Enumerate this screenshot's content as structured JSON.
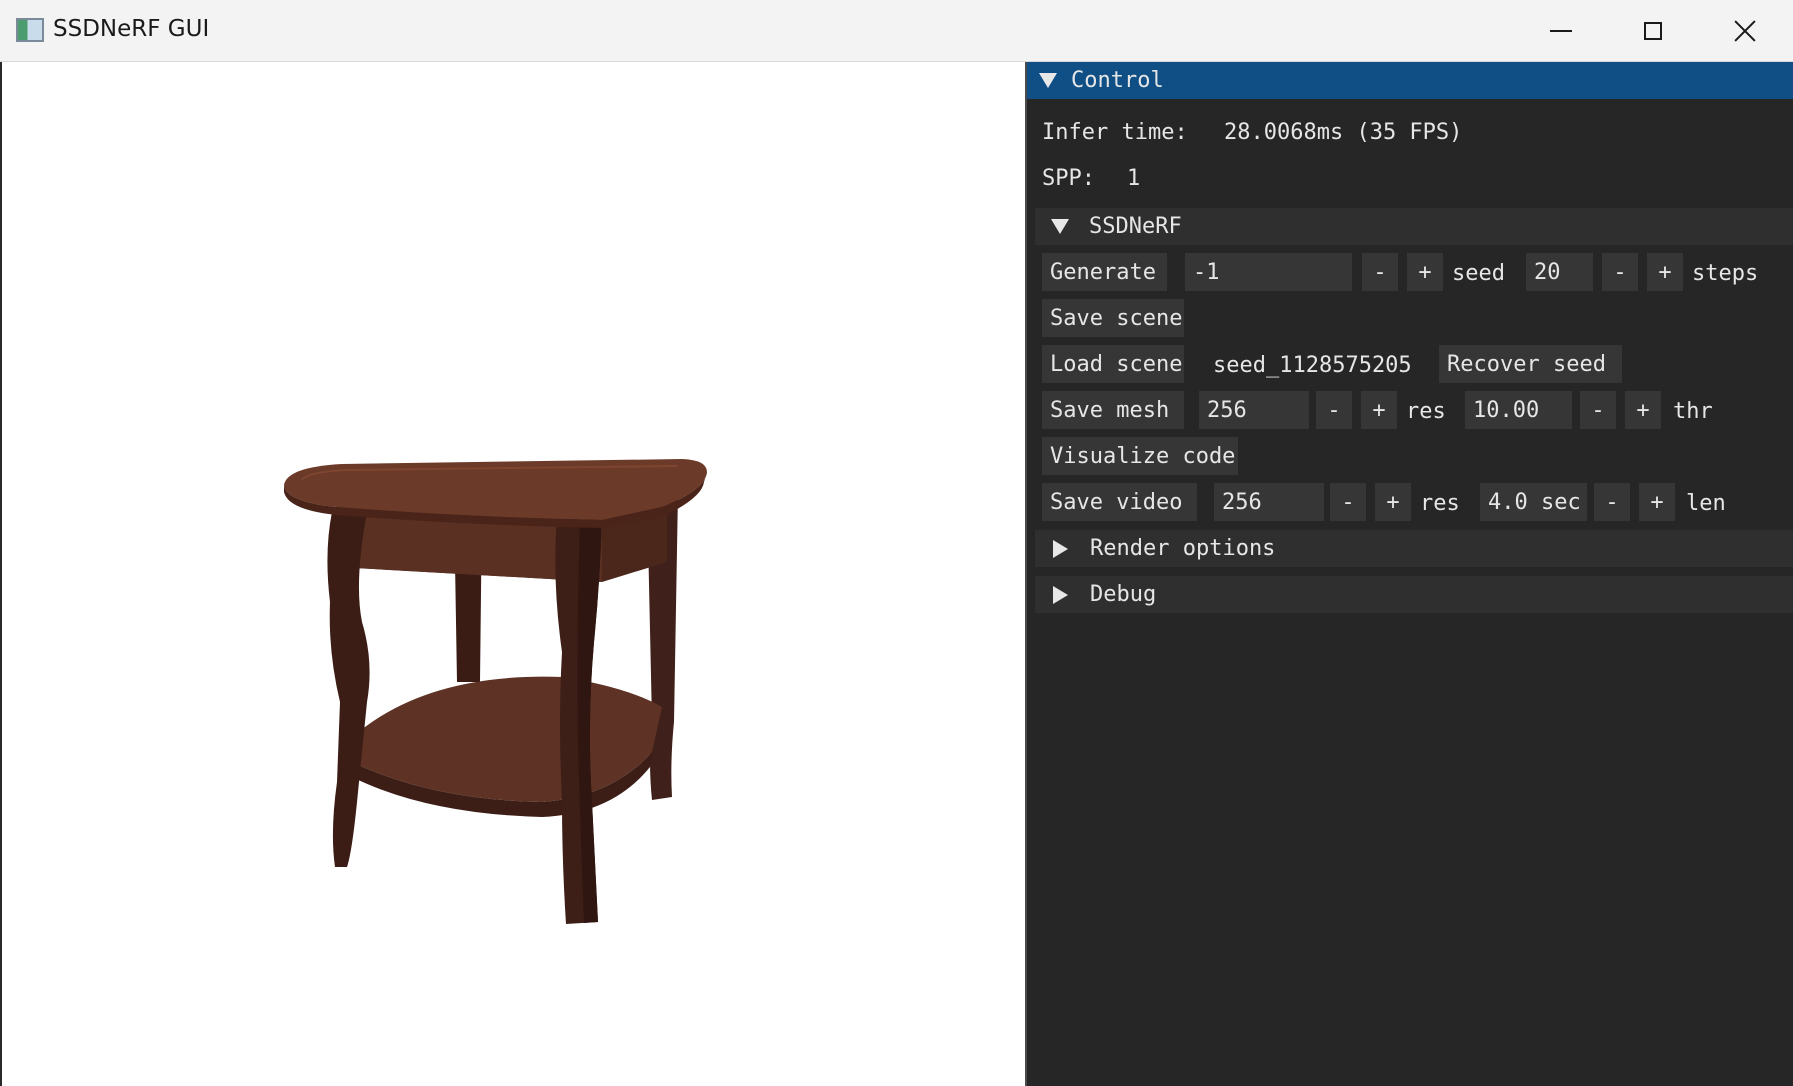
{
  "window": {
    "title": "SSDNeRF GUI",
    "controls": [
      "minimize",
      "maximize",
      "close"
    ]
  },
  "viewport": {
    "content": "rendered wooden side table",
    "colors": {
      "wood_dark": "#3e1f17",
      "wood_mid": "#5a3123",
      "wood_top": "#6b3a29",
      "background": "#ffffff"
    }
  },
  "control": {
    "header": "Control",
    "infer_label": "Infer time:",
    "infer_value": "28.0068ms (35 FPS)",
    "spp_label": "SPP:",
    "spp_value": "1",
    "ssdnerf": {
      "header": "SSDNeRF",
      "generate_label": "Generate",
      "seed_value": "-1",
      "seed_label": "seed",
      "steps_value": "20",
      "steps_label": "steps",
      "save_scene_label": "Save scene",
      "load_scene_label": "Load scene",
      "scene_name": "seed_1128575205",
      "recover_seed_label": "Recover seed",
      "save_mesh_label": "Save mesh",
      "mesh_res_value": "256",
      "mesh_res_label": "res",
      "thr_value": "10.00",
      "thr_label": "thr",
      "visualize_code_label": "Visualize code",
      "save_video_label": "Save video",
      "video_res_value": "256",
      "video_res_label": "res",
      "len_value": "4.0 sec",
      "len_label": "len",
      "minus": "-",
      "plus": "+"
    },
    "render_options_header": "Render options",
    "debug_header": "Debug"
  },
  "colors": {
    "panel_bg": "#262626",
    "header_bg": "#0f4f86",
    "widget_bg": "#363636",
    "text": "#e6e6e6"
  }
}
